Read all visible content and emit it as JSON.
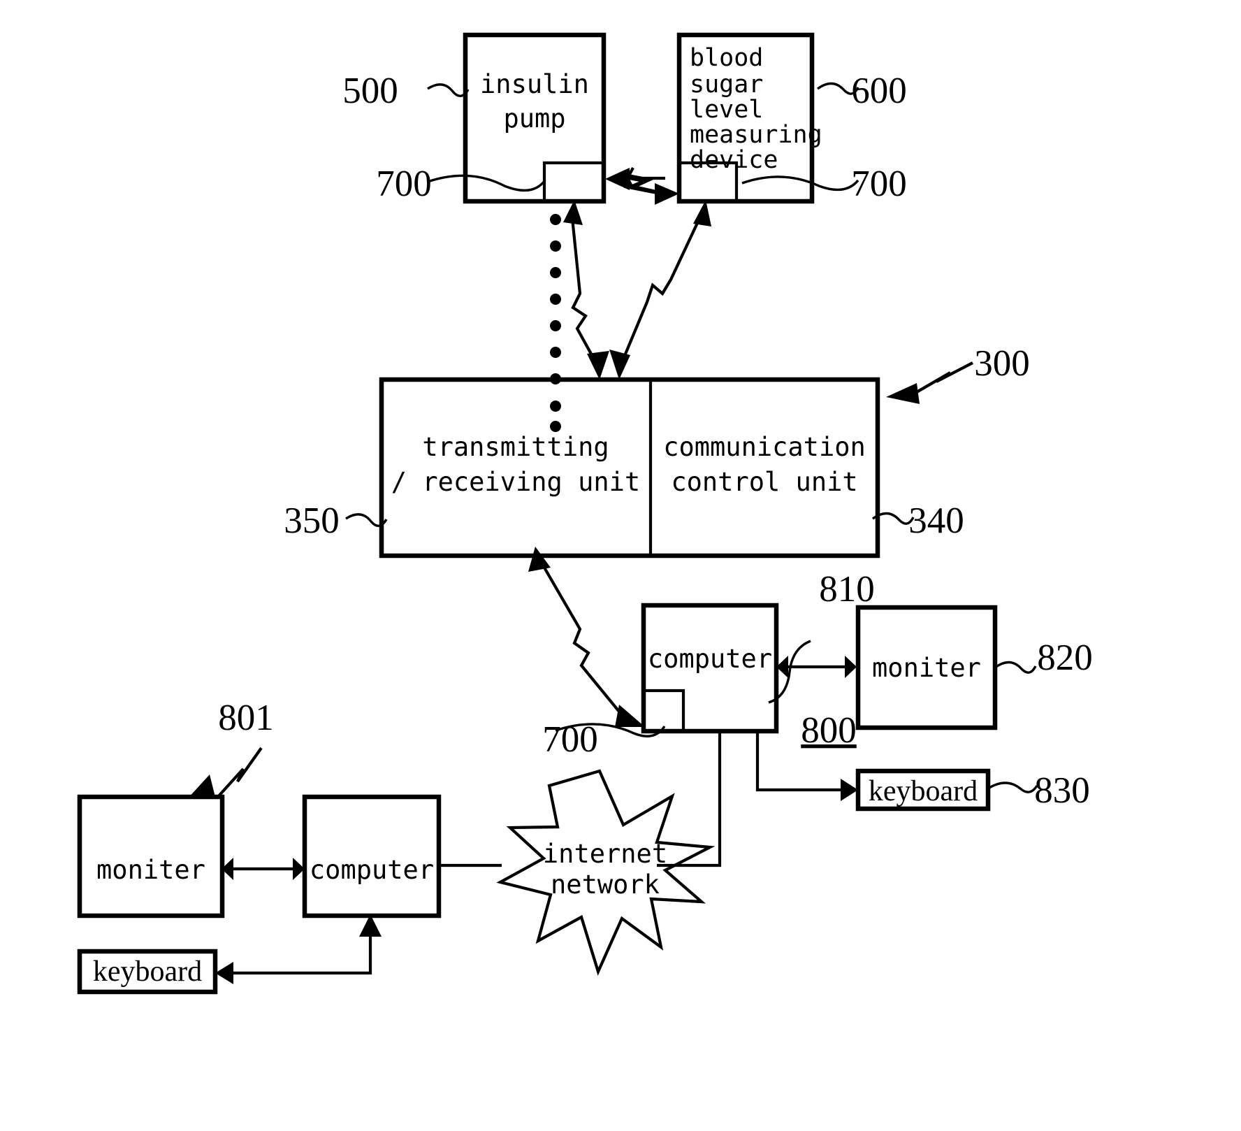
{
  "figure": {
    "type": "patent-block-diagram",
    "description": "Insulin pump / blood sugar measuring device telemetry system block diagram"
  },
  "blocks": {
    "insulin_pump": {
      "label": "insulin\npump",
      "line1": "insulin",
      "line2": "pump",
      "ref": "500"
    },
    "blood_sugar": {
      "line1": "blood",
      "line2": "sugar",
      "line3": "level",
      "line4": "measuring",
      "line5": "device",
      "ref": "600"
    },
    "transmitting_unit": {
      "line1": "transmitting",
      "line2": "/ receiving unit",
      "ref": "350"
    },
    "communication_unit": {
      "line1": "communication",
      "line2": "control unit",
      "ref": "340"
    },
    "gateway_group_ref": "300",
    "computer_right": {
      "label": "computer",
      "ref": "810"
    },
    "moniter_right": {
      "label": "moniter",
      "ref": "820"
    },
    "keyboard_right": {
      "label": "keyboard",
      "ref": "830"
    },
    "terminal_right_group_ref": "800",
    "moniter_left": {
      "label": "moniter"
    },
    "computer_left": {
      "label": "computer"
    },
    "keyboard_left": {
      "label": "keyboard"
    },
    "terminal_left_group_ref": "801",
    "internet": {
      "line1": "internet",
      "line2": "network"
    }
  },
  "ref_numbers": {
    "pump": "500",
    "meter": "600",
    "comm_module_pump": "700",
    "comm_module_meter": "700",
    "comm_module_computer": "700",
    "gateway": "300",
    "transmit_receive": "350",
    "comm_control": "340",
    "computer_right": "810",
    "moniter_right": "820",
    "keyboard_right": "830",
    "terminal_right": "800",
    "terminal_left": "801"
  }
}
